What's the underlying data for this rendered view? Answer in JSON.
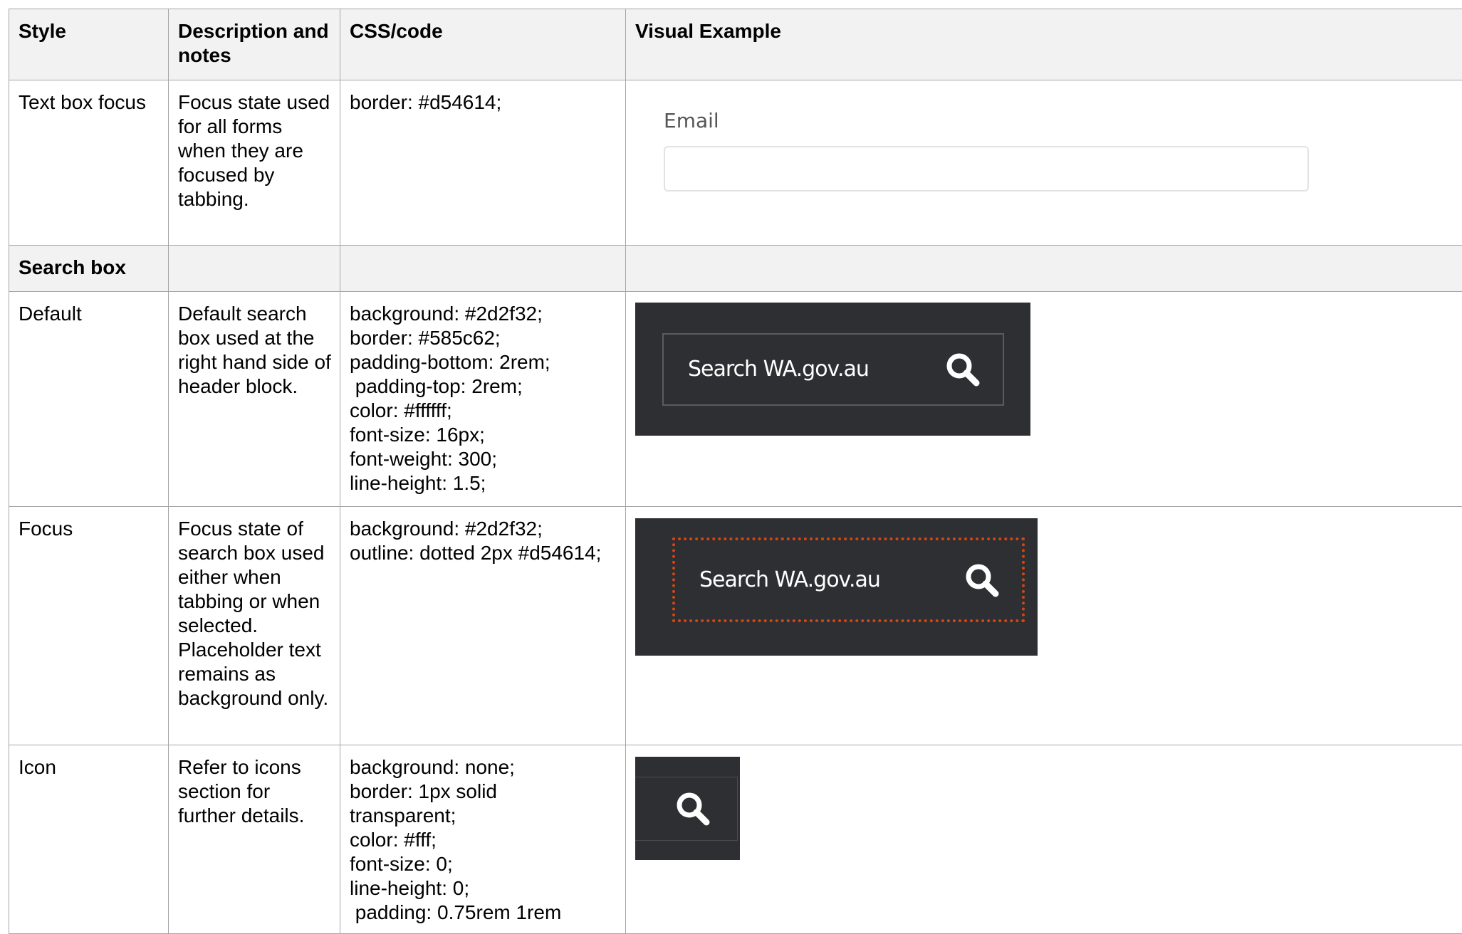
{
  "table": {
    "headers": {
      "style": "Style",
      "description": "Description and notes",
      "css": "CSS/code",
      "visual": "Visual Example"
    },
    "rows": {
      "text_box_focus": {
        "style": "Text box focus",
        "description": "Focus state used for all forms when they are focused by tabbing.",
        "css": [
          "border: #d54614;"
        ],
        "visual": {
          "label": "Email",
          "input_value": ""
        }
      },
      "section_search_box": {
        "title": "Search box"
      },
      "default": {
        "style": "Default",
        "description": "Default search box used at the right hand side of header block.",
        "css": [
          "background: #2d2f32;",
          "border: #585c62;",
          "padding-bottom: 2rem;",
          " padding-top: 2rem;",
          "color: #ffffff;",
          "font-size: 16px;",
          "font-weight: 300;",
          "line-height: 1.5;"
        ],
        "visual": {
          "placeholder": "Search WA.gov.au",
          "icon": "search-icon"
        }
      },
      "focus": {
        "style": "Focus",
        "description": "Focus state of search box used either when tabbing or when selected. Placeholder text remains as background only.",
        "css": [
          "background: #2d2f32;",
          "outline: dotted 2px #d54614;"
        ],
        "visual": {
          "placeholder": "Search WA.gov.au",
          "icon": "search-icon"
        }
      },
      "icon": {
        "style": "Icon",
        "description": "Refer to icons section for further details.",
        "css": [
          "background: none;",
          "border: 1px solid",
          "transparent;",
          "color: #fff;",
          "font-size: 0;",
          "line-height: 0;",
          " padding: 0.75rem 1rem"
        ],
        "visual": {
          "icon": "search-icon"
        }
      }
    }
  },
  "colors": {
    "header_bg": "#f2f2f2",
    "dark_bg": "#2d2f32",
    "search_border": "#585c62",
    "focus_outline": "#d54614",
    "text_white": "#ffffff"
  }
}
